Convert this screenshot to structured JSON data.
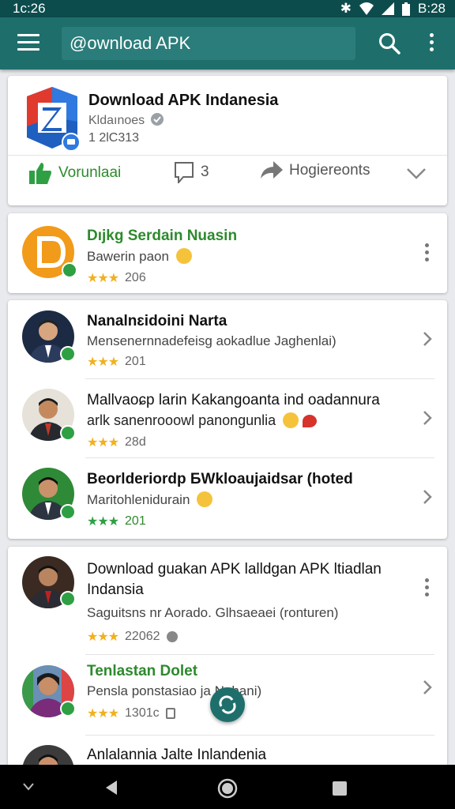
{
  "status_bar": {
    "time": "1ᴄ:26",
    "right_time": "B:28"
  },
  "app_bar": {
    "search_value": "@ownload APK"
  },
  "app_card": {
    "title": "Download APK Indanesia",
    "subtitle": "Kldaınoes",
    "count": "1 2lC313",
    "actions": {
      "like_label": "Vorunlaai",
      "comment_count": "3",
      "share_label": "Hogiereonts"
    }
  },
  "featured": {
    "title": "Dıjkg Serdain Nuasin",
    "subtitle": "Bawerin paon",
    "rating": "206"
  },
  "list": [
    {
      "title": "Nanalnɛidoini Narta",
      "subtitle": "Mensenernnadefeisg aokadlue Jaghenlai)",
      "rating": "201"
    },
    {
      "title": "Mallvaoɕp larin Kakangoanta ind oadannura",
      "title2": "arlk sanenrooowl panongunlia",
      "rating": "28d"
    },
    {
      "title": "Beorlderiordp БWkloaujaidsar (hoted",
      "subtitle": "Maritohlenidurain",
      "rating": "201"
    }
  ],
  "list2": [
    {
      "title": "Download guakan APK lalldgan APK ltiadlan",
      "title2": "Indansia",
      "subtitle": "Saguitsns nr Aorado.  Glhsaeaei (ronturen)",
      "rating": "22062"
    },
    {
      "title": "Tenlastan Dolet",
      "subtitle": "Pensla ponstasiao  ja   Nahani)",
      "rating": "1301ᴄ"
    },
    {
      "title": "Anlalannia Jalte Inlandenia"
    }
  ],
  "colors": {
    "teal": "#1e6f6c",
    "green": "#2ea043",
    "star": "#f2b01e"
  }
}
